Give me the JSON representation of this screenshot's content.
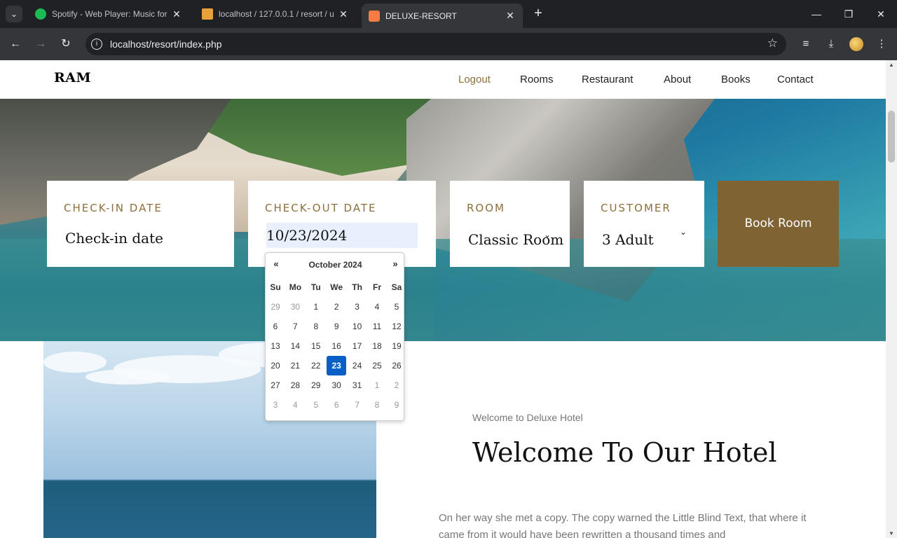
{
  "browser": {
    "tabs": [
      {
        "title": "Spotify - Web Player: Music for",
        "favicon_color": "#1db954",
        "active": false
      },
      {
        "title": "localhost / 127.0.0.1 / resort / u",
        "favicon_color": "#e8a23b",
        "active": false
      },
      {
        "title": "DELUXE-RESORT",
        "favicon_color": "#f57c44",
        "active": true
      }
    ],
    "url": "localhost/resort/index.php"
  },
  "site": {
    "brand": "RAM",
    "nav": [
      "Logout",
      "Rooms",
      "Restaurant",
      "About",
      "Books",
      "Contact"
    ]
  },
  "booking": {
    "checkin_label": "CHECK-IN DATE",
    "checkin_placeholder": "Check-in date",
    "checkout_label": "CHECK-OUT DATE",
    "checkout_value": "10/23/2024",
    "room_label": "ROOM",
    "room_value": "Classic Room",
    "customer_label": "CUSTOMER",
    "customer_value": "3 Adult",
    "book_button": "Book Room"
  },
  "datepicker": {
    "prev": "«",
    "next": "»",
    "month": "October 2024",
    "weekdays": [
      "Su",
      "Mo",
      "Tu",
      "We",
      "Th",
      "Fr",
      "Sa"
    ],
    "weeks": [
      [
        {
          "d": "29",
          "o": true
        },
        {
          "d": "30",
          "o": true
        },
        {
          "d": "1"
        },
        {
          "d": "2"
        },
        {
          "d": "3"
        },
        {
          "d": "4"
        },
        {
          "d": "5"
        }
      ],
      [
        {
          "d": "6"
        },
        {
          "d": "7"
        },
        {
          "d": "8"
        },
        {
          "d": "9"
        },
        {
          "d": "10"
        },
        {
          "d": "11"
        },
        {
          "d": "12"
        }
      ],
      [
        {
          "d": "13"
        },
        {
          "d": "14"
        },
        {
          "d": "15"
        },
        {
          "d": "16"
        },
        {
          "d": "17"
        },
        {
          "d": "18"
        },
        {
          "d": "19"
        }
      ],
      [
        {
          "d": "20"
        },
        {
          "d": "21"
        },
        {
          "d": "22"
        },
        {
          "d": "23",
          "s": true
        },
        {
          "d": "24"
        },
        {
          "d": "25"
        },
        {
          "d": "26"
        }
      ],
      [
        {
          "d": "27"
        },
        {
          "d": "28"
        },
        {
          "d": "29"
        },
        {
          "d": "30"
        },
        {
          "d": "31"
        },
        {
          "d": "1",
          "o": true
        },
        {
          "d": "2",
          "o": true
        }
      ],
      [
        {
          "d": "3",
          "o": true
        },
        {
          "d": "4",
          "o": true
        },
        {
          "d": "5",
          "o": true
        },
        {
          "d": "6",
          "o": true
        },
        {
          "d": "7",
          "o": true
        },
        {
          "d": "8",
          "o": true
        },
        {
          "d": "9",
          "o": true
        }
      ]
    ]
  },
  "welcome": {
    "small": "Welcome to Deluxe Hotel",
    "title": "Welcome To Our Hotel",
    "paragraph": "On her way she met a copy. The copy warned the Little Blind Text, that where it came from it would have been rewritten a thousand times and"
  },
  "colors": {
    "accent": "#8d703b",
    "book_button": "#806333",
    "selected_day": "#0860c7"
  }
}
